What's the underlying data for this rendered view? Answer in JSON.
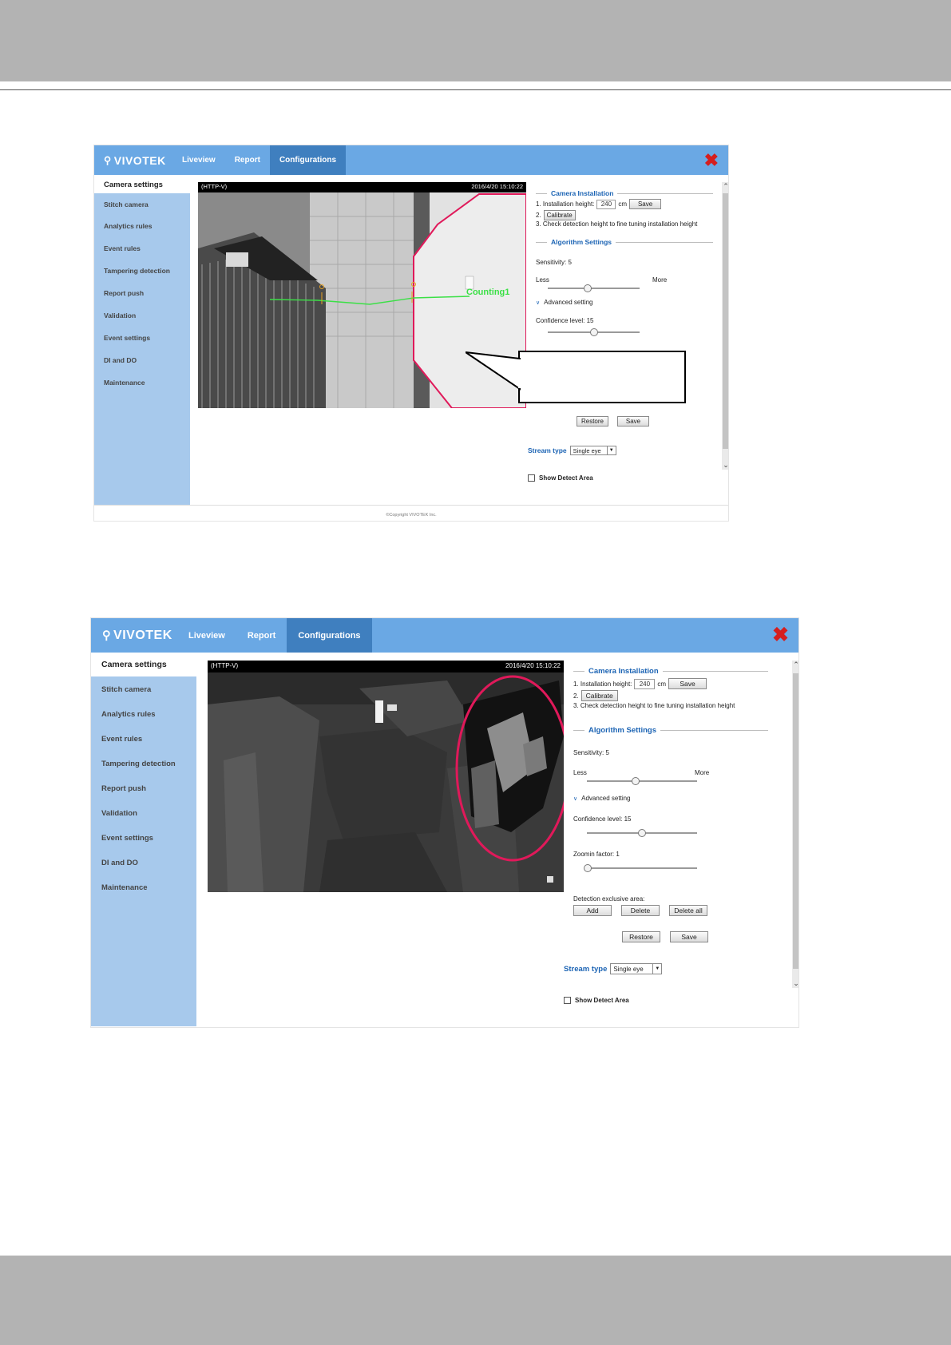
{
  "window_top": {
    "brand": "VIVOTEK",
    "tabs": [
      "Liveview",
      "Report",
      "Configurations"
    ],
    "close_icon": "close-x-icon",
    "close_color": "#d51e1e"
  },
  "sidebar": {
    "active": "Camera settings",
    "items": [
      "Stitch camera",
      "Analytics rules",
      "Event rules",
      "Tampering detection",
      "Report push",
      "Validation",
      "Event settings",
      "DI and DO",
      "Maintenance"
    ]
  },
  "video": {
    "protocol": "(HTTP-V)",
    "timestamp": "2016/4/20 15:10:22",
    "counting_label": "Counting1"
  },
  "camera_installation": {
    "title": "Camera Installation",
    "step1_label": "1. Installation height:",
    "height_value": "240",
    "unit": "cm",
    "save": "Save",
    "step2_label": "2.",
    "calibrate": "Calibrate",
    "step3_label": "3. Check detection height to fine tuning installation height"
  },
  "algorithm": {
    "title": "Algorithm Settings",
    "sensitivity_label": "Sensitivity: 5",
    "sensitivity_level": 5,
    "less": "Less",
    "more": "More",
    "advanced": "Advanced setting",
    "confidence_label": "Confidence level: 15",
    "confidence_level": 15,
    "zoomin_label": "Zoomin factor: 1",
    "zoomin_level": 1,
    "exclusive_label": "Detection exclusive area:",
    "add": "Add",
    "delete": "Delete",
    "delete_all": "Delete all",
    "restore": "Restore",
    "save": "Save"
  },
  "stream": {
    "label": "Stream type",
    "value": "Single eye"
  },
  "show_detect_area": "Show Detect Area",
  "copyright": "©Copyright VIVOTEK Inc.",
  "colors": {
    "topbar": "#6aa8e4",
    "active_tab": "#3f7fbf",
    "sidebar": "#a7c9ec",
    "section_heading": "#1c64b4",
    "highlight": "#e0195a"
  }
}
